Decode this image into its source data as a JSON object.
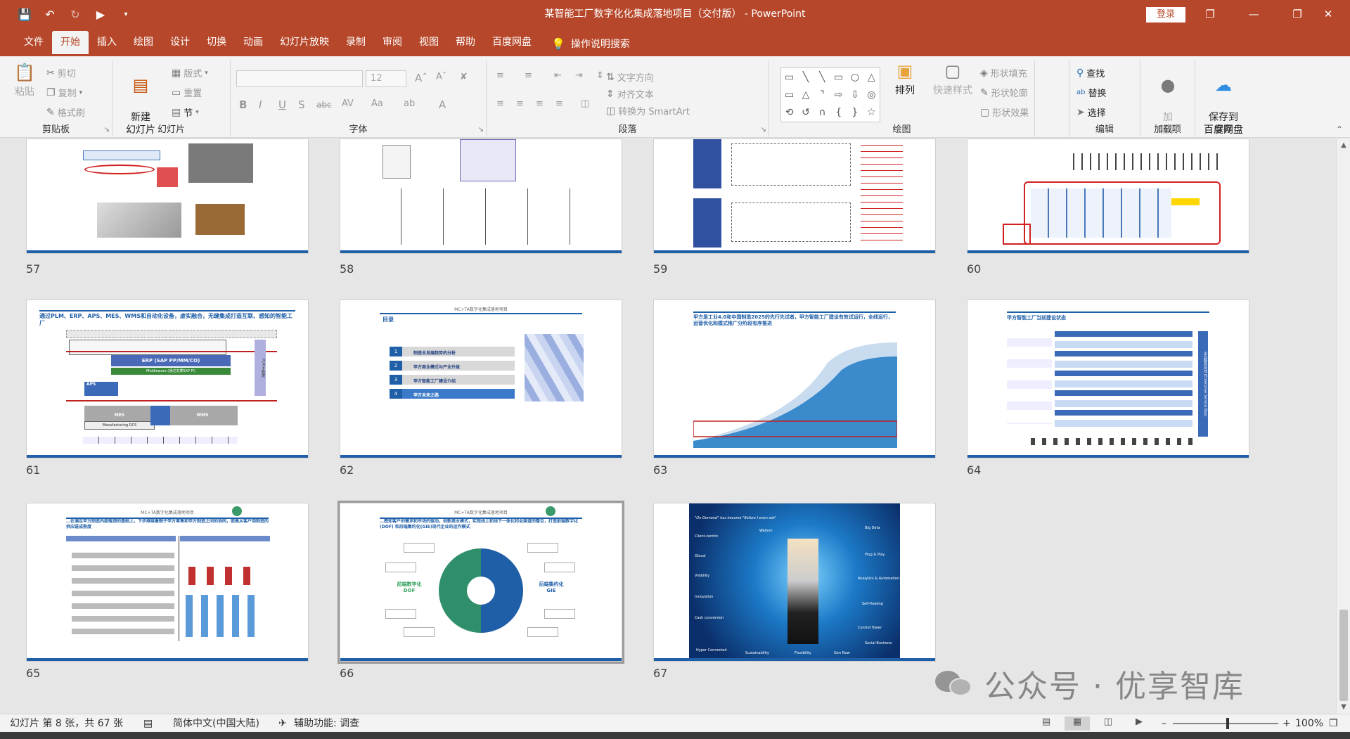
{
  "window": {
    "title": "某智能工厂数字化化集成落地项目（交付版） -  PowerPoint",
    "login_label": "登录",
    "controls": [
      "❐",
      "—",
      "❐",
      "✕"
    ]
  },
  "tabs": [
    {
      "label": "文件"
    },
    {
      "label": "开始"
    },
    {
      "label": "插入"
    },
    {
      "label": "绘图"
    },
    {
      "label": "设计"
    },
    {
      "label": "切换"
    },
    {
      "label": "动画"
    },
    {
      "label": "幻灯片放映"
    },
    {
      "label": "录制"
    },
    {
      "label": "审阅"
    },
    {
      "label": "视图"
    },
    {
      "label": "帮助"
    },
    {
      "label": "百度网盘"
    }
  ],
  "tell_me": "操作说明搜索",
  "ribbon": {
    "clipboard": {
      "label": "剪贴板",
      "paste": "粘贴",
      "cut": "剪切",
      "copy": "复制",
      "format_painter": "格式刷"
    },
    "slides": {
      "label": "幻灯片",
      "new_slide": "新建\n幻灯片",
      "layout": "版式",
      "reset": "重置",
      "section": "节"
    },
    "font": {
      "label": "字体",
      "size": "12"
    },
    "paragraph": {
      "label": "段落",
      "text_direction": "文字方向",
      "align_text": "对齐文本",
      "smartart": "转换为 SmartArt"
    },
    "drawing": {
      "label": "绘图",
      "arrange": "排列",
      "quick_styles": "快速样式",
      "shape_fill": "形状填充",
      "shape_outline": "形状轮廓",
      "shape_effects": "形状效果"
    },
    "editing": {
      "label": "编辑",
      "find": "查找",
      "replace": "替换",
      "select": "选择"
    },
    "addins": {
      "label": "加载项",
      "addins": "加\n载项"
    },
    "save": {
      "label": "保存",
      "save_baidu": "保存到\n百度网盘"
    }
  },
  "slides": [
    {
      "number": "57"
    },
    {
      "number": "58"
    },
    {
      "number": "59"
    },
    {
      "number": "60"
    },
    {
      "number": "61"
    },
    {
      "number": "62"
    },
    {
      "number": "63"
    },
    {
      "number": "64"
    },
    {
      "number": "65"
    },
    {
      "number": "66"
    },
    {
      "number": "67"
    }
  ],
  "slide_texts": {
    "s61_title": "通过PLM、ERP、APS、MES、WMS和自动化设备，虚实融合，无缝集成打造互联、感知的智能工厂",
    "s61_erp": "ERP (SAP PP/MM/CO)",
    "s61_mw": "Middleware (通过支撑SAP PI)",
    "s61_mes": "MES",
    "s61_wms": "WMS",
    "s61_aps": "APS",
    "s61_dcs": "Manufacturing DCS",
    "s61_plm": "PLM 主数据",
    "s62_header": "MC+TA数字化集成落地项目",
    "s62_toc": "目录",
    "s62_items": [
      {
        "num": "1",
        "text": "制造业发展趋势的分析"
      },
      {
        "num": "2",
        "text": "甲方商业模式与产业升级"
      },
      {
        "num": "3",
        "text": "甲方智能工厂建设介绍"
      },
      {
        "num": "4",
        "text": "甲方未来之路"
      }
    ],
    "s63_title": "甲方是工业4.0和中国制造2025的先行先试者，甲方智能工厂建设有效试运行，全线运行，运营优化和模式推广分阶段有序推进",
    "s64_title": "甲方智能工厂当前建设状态",
    "s64_esb": "企业服务总线 (Enterprise Service Bus)",
    "s65_title": "…在满足甲方制造内部瓶颈的基础上，下步继续着眼于甲方零售和甲方制造之间的协同，提高从客户到制造的供应链成熟度",
    "s66_title": "…感知客户的需求和市场的驱动，创新商业模式，实现线上和线下一体化和全渠道的整合，打造前端数字化(DOF) 和后端集约化(GIE)现代企业的运作模式",
    "s66_left": "前端数字化\nDOF",
    "s66_right": "后端集约化\nGIE",
    "s67_top": "\"On Demand\" has become \"Before I even ask\"",
    "s67_left": [
      "Client-centric",
      "Glocal",
      "Visibility",
      "Innovation",
      "Cash conversion"
    ],
    "s67_right": [
      "Big Data",
      "Plug & Play",
      "Analytics & Automation",
      "Self-Healing",
      "Control Tower",
      "Social Business"
    ],
    "s67_bottom": [
      "Hyper Connected",
      "Sustainability",
      "Flexibility",
      "Gen Now"
    ],
    "s67_watson": "Watson"
  },
  "watermark": "公众号 · 优享智库",
  "statusbar": {
    "slide_info": "幻灯片 第 8 张，共 67 张",
    "language": "简体中文(中国大陆)",
    "accessibility": "辅助功能: 调查",
    "zoom": "100%"
  }
}
